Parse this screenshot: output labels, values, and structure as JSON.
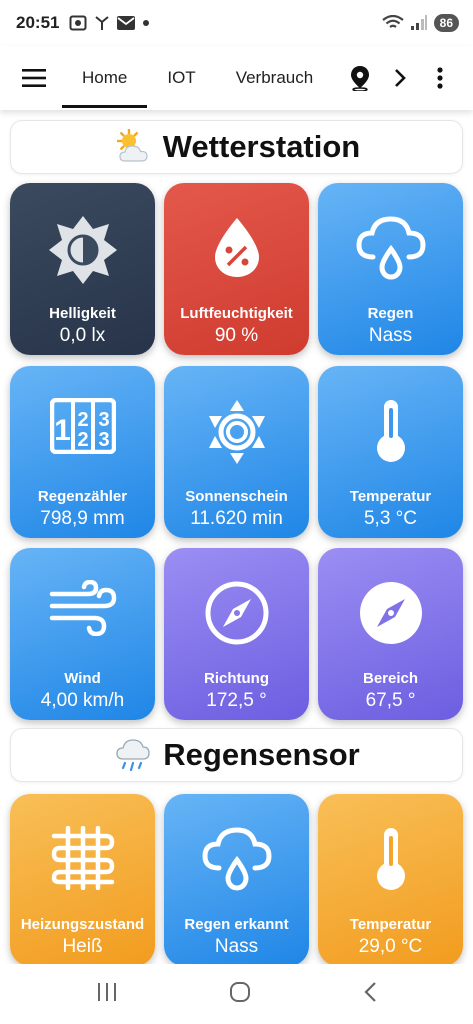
{
  "status_bar": {
    "time": "20:51",
    "battery": "86"
  },
  "tabs": [
    {
      "label": "Home",
      "active": true
    },
    {
      "label": "IOT",
      "active": false
    },
    {
      "label": "Verbrauch",
      "active": false
    }
  ],
  "sections": [
    {
      "title": "Wetterstation",
      "icon": "sun-behind-cloud-icon",
      "tiles": [
        {
          "label": "Helligkeit",
          "value": "0,0 lx",
          "icon": "brightness-icon",
          "color": "dark"
        },
        {
          "label": "Luftfeuchtigkeit",
          "value": "90 %",
          "icon": "humidity-drop-icon",
          "color": "red"
        },
        {
          "label": "Regen",
          "value": "Nass",
          "icon": "cloud-rain-icon",
          "color": "blue"
        },
        {
          "label": "Regenzähler",
          "value": "798,9 mm",
          "icon": "counter-icon",
          "color": "blue"
        },
        {
          "label": "Sonnenschein",
          "value": "11.620 min",
          "icon": "sun-icon",
          "color": "blue"
        },
        {
          "label": "Temperatur",
          "value": "5,3 °C",
          "icon": "thermometer-icon",
          "color": "blue"
        },
        {
          "label": "Wind",
          "value": "4,00 km/h",
          "icon": "wind-icon",
          "color": "blue"
        },
        {
          "label": "Richtung",
          "value": "172,5 °",
          "icon": "compass-icon",
          "color": "purple"
        },
        {
          "label": "Bereich",
          "value": "67,5 °",
          "icon": "compass-icon",
          "color": "purple"
        }
      ]
    },
    {
      "title": "Regensensor",
      "icon": "cloud-with-rain-icon",
      "tiles": [
        {
          "label": "Heizungszustand",
          "value": "Heiß",
          "icon": "heating-coil-icon",
          "color": "orange"
        },
        {
          "label": "Regen erkannt",
          "value": "Nass",
          "icon": "cloud-rain-icon",
          "color": "blue"
        },
        {
          "label": "Temperatur",
          "value": "29,0 °C",
          "icon": "thermometer-icon",
          "color": "orange"
        }
      ]
    }
  ]
}
